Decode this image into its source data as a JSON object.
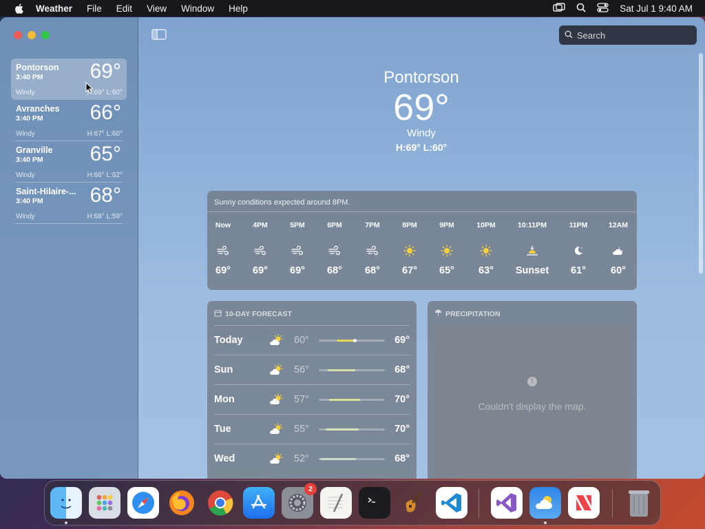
{
  "menubar": {
    "app_name": "Weather",
    "items": [
      "File",
      "Edit",
      "View",
      "Window",
      "Help"
    ],
    "clock": "Sat Jul 1  9:40 AM"
  },
  "search": {
    "placeholder": "Search"
  },
  "sidebar": {
    "cities": [
      {
        "name": "Pontorson",
        "time": "3:40 PM",
        "temp": "69°",
        "condition": "Windy",
        "hl": "H:69°  L:60°"
      },
      {
        "name": "Avranches",
        "time": "3:40 PM",
        "temp": "66°",
        "condition": "Windy",
        "hl": "H:67°  L:60°"
      },
      {
        "name": "Granville",
        "time": "3:40 PM",
        "temp": "65°",
        "condition": "Windy",
        "hl": "H:66°  L:62°"
      },
      {
        "name": "Saint-Hilaire-...",
        "time": "3:40 PM",
        "temp": "68°",
        "condition": "Windy",
        "hl": "H:68°  L:59°"
      }
    ]
  },
  "current": {
    "city": "Pontorson",
    "temp": "69°",
    "condition": "Windy",
    "hl": "H:69°  L:60°"
  },
  "hourly": {
    "summary": "Sunny conditions expected around 8PM.",
    "hours": [
      {
        "label": "Now",
        "icon": "wind-icon",
        "temp": "69°"
      },
      {
        "label": "4PM",
        "icon": "wind-icon",
        "temp": "69°"
      },
      {
        "label": "5PM",
        "icon": "wind-icon",
        "temp": "69°"
      },
      {
        "label": "6PM",
        "icon": "wind-icon",
        "temp": "68°"
      },
      {
        "label": "7PM",
        "icon": "wind-icon",
        "temp": "68°"
      },
      {
        "label": "8PM",
        "icon": "sun-icon",
        "temp": "67°"
      },
      {
        "label": "9PM",
        "icon": "sun-icon",
        "temp": "65°"
      },
      {
        "label": "10PM",
        "icon": "sun-icon",
        "temp": "63°"
      },
      {
        "label": "10:11PM",
        "icon": "sunset-icon",
        "temp": "Sunset"
      },
      {
        "label": "11PM",
        "icon": "moon-icon",
        "temp": "61°"
      },
      {
        "label": "12AM",
        "icon": "cloud-moon-icon",
        "temp": "60°"
      }
    ]
  },
  "forecast": {
    "title": "10-DAY FORECAST",
    "days": [
      {
        "day": "Today",
        "icon": "partly-sunny-icon",
        "lo": "60°",
        "hi": "69°",
        "range": [
          0.27,
          0.55
        ],
        "current": 0.55,
        "color": "#e8d85a"
      },
      {
        "day": "Sun",
        "icon": "partly-sunny-icon",
        "lo": "56°",
        "hi": "68°",
        "range": [
          0.14,
          0.55
        ],
        "color": "#d7e0a6"
      },
      {
        "day": "Mon",
        "icon": "partly-sunny-icon",
        "lo": "57°",
        "hi": "70°",
        "range": [
          0.16,
          0.62
        ],
        "color": "#dfe39a"
      },
      {
        "day": "Tue",
        "icon": "partly-sunny-icon",
        "lo": "55°",
        "hi": "70°",
        "range": [
          0.1,
          0.6
        ],
        "color": "#d8e2b2"
      },
      {
        "day": "Wed",
        "icon": "partly-sunny-icon",
        "lo": "52°",
        "hi": "68°",
        "range": [
          0.02,
          0.56
        ],
        "color": "#cfdbc4"
      }
    ]
  },
  "precipitation": {
    "title": "PRECIPITATION",
    "message": "Couldn't display the map."
  },
  "dock": {
    "apps": [
      "finder-icon",
      "launchpad-icon",
      "safari-icon",
      "firefox-icon",
      "chrome-icon",
      "app-store-icon",
      "system-settings-icon",
      "textedit-icon",
      "terminal-icon",
      "garageband-icon",
      "vscode-icon",
      "visual-studio-icon",
      "weather-app-icon",
      "news-icon",
      "trash-icon"
    ],
    "settings_badge": "2"
  }
}
